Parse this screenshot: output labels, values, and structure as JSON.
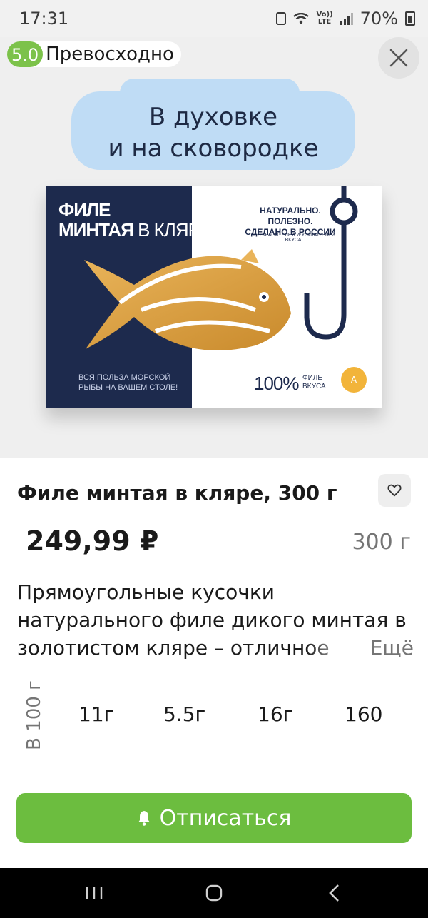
{
  "status_bar": {
    "time": "17:31",
    "lte_top": "Vo))",
    "lte_bottom": "LTE",
    "battery": "70%"
  },
  "hero": {
    "rating_score": "5.0",
    "rating_label": "Превосходно",
    "bubble_line1": "В духовке",
    "bubble_line2": "и на сковородке",
    "pack": {
      "title_line1": "ФИЛЕ",
      "title_line2a": "МИНТАЯ",
      "title_line2b": " В КЛЯРЕ",
      "tagline1": "НАТУРАЛЬНО. ПОЛЕЗНО.",
      "tagline2": "СДЕЛАНО В РОССИИ",
      "no_additives": "БЕЗ КРАСИТЕЛЕЙ И УСИЛИТЕЛЕЙ ВКУСА",
      "benefit1": "ВСЯ ПОЛЬЗА МОРСКОЙ",
      "benefit2": "РЫБЫ НА ВАШЕМ СТОЛЕ!",
      "percent": "100%",
      "percent_label1": "ФИЛЕ",
      "percent_label2": "ВКУСА",
      "badge": "A"
    }
  },
  "product": {
    "title": "Филе минтая в кляре, 300 г",
    "price": "249,99 ₽",
    "weight": "300 г",
    "description": "Прямоугольные кусочки натурального филе дикого минтая в золотистом кляре – отличное",
    "more": "Ещё"
  },
  "nutrition": {
    "header": "В 100 г",
    "values": [
      "11г",
      "5.5г",
      "16г",
      "160"
    ]
  },
  "cta": {
    "label": "Отписаться",
    "icon": "bell-icon"
  },
  "colors": {
    "accent_green": "#6cbd3f",
    "rating_green": "#7cc24a",
    "pack_navy": "#1d2a4d",
    "bubble_blue": "#bfdcf5"
  }
}
